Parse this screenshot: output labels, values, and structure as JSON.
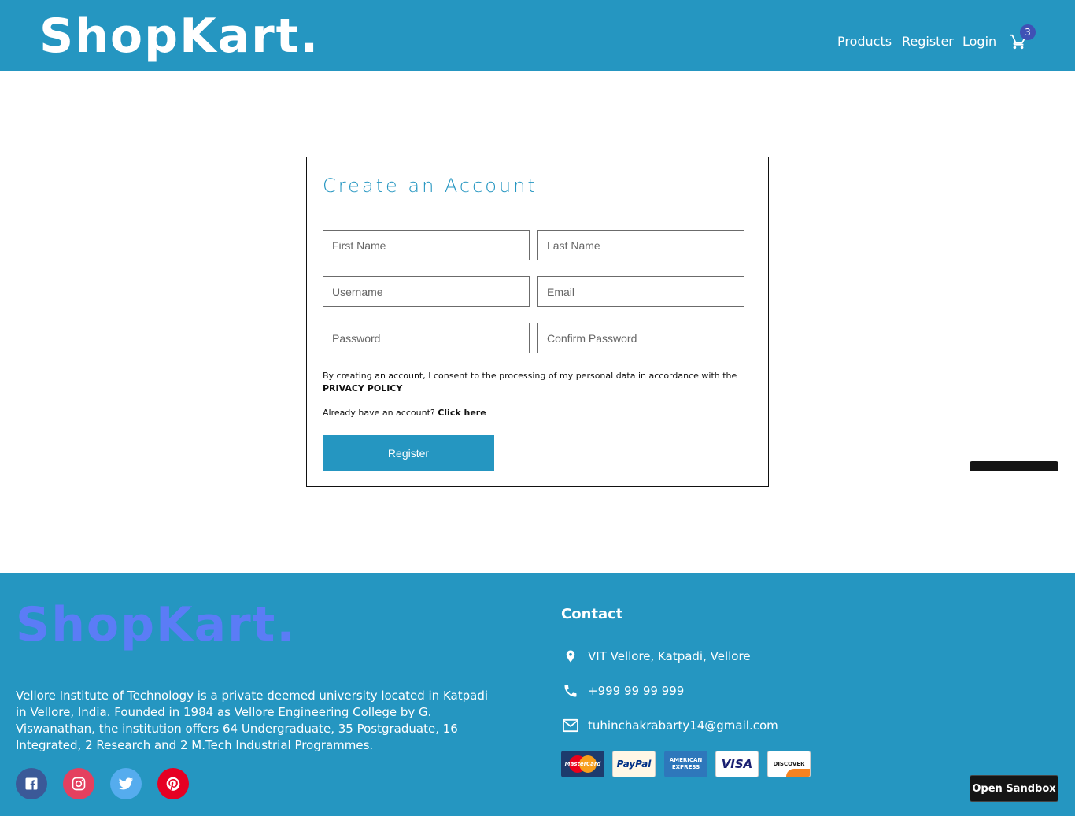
{
  "header": {
    "logo": "ShopKart.",
    "nav": {
      "products": "Products",
      "register": "Register",
      "login": "Login"
    },
    "cart_count": "3",
    "cart_icon": "shopping-cart-icon"
  },
  "form": {
    "title": "Create an Account",
    "fields": {
      "first_name": "First Name",
      "last_name": "Last Name",
      "username": "Username",
      "email": "Email",
      "password": "Password",
      "confirm_password": "Confirm Password"
    },
    "consent_text": "By creating an account, I consent to the processing of my personal data in accordance with the",
    "privacy_policy": "PRIVACY POLICY",
    "already_text": "Already have an account?",
    "click_here": "Click here",
    "register_button": "Register"
  },
  "footer": {
    "logo": "ShopKart.",
    "description": "Vellore Institute of Technology is a private deemed university located in Katpadi in Vellore, India. Founded in 1984 as Vellore Engineering College by G. Viswanathan, the institution offers 64 Undergraduate, 35 Postgraduate, 16 Integrated, 2 Research and 2 M.Tech Industrial Programmes.",
    "social": [
      "facebook-icon",
      "instagram-icon",
      "twitter-icon",
      "pinterest-icon"
    ],
    "contact": {
      "title": "Contact",
      "address": "VIT Vellore, Katpadi, Vellore",
      "phone": "+999 99 99 999",
      "email": "tuhinchakrabarty14@gmail.com"
    },
    "payments": {
      "mastercard": "MasterCard",
      "paypal": "PayPal",
      "amex_line1": "AMERICAN",
      "amex_line2": "EXPRESS",
      "visa": "VISA",
      "discover": "DISCOVER"
    }
  },
  "sandbox_button": "Open Sandbox",
  "colors": {
    "brand": "#2596c1",
    "footer_logo": "#5b7cf6",
    "badge": "#3f51b5"
  }
}
